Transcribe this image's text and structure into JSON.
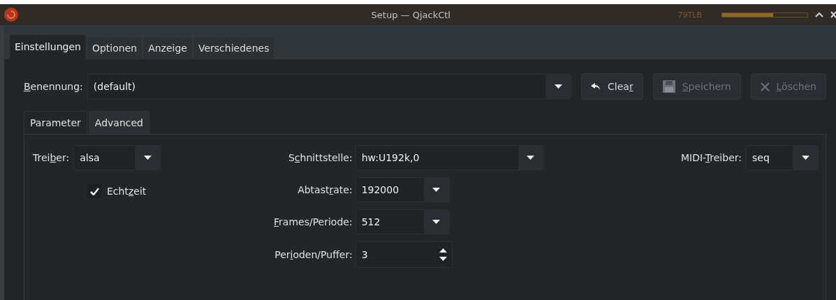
{
  "window": {
    "title": "Setup — QjackCtl",
    "overlay_text": "79TLB",
    "meter": {
      "level": 0.6
    }
  },
  "tabs": [
    {
      "label": "Einstellungen",
      "selected": true
    },
    {
      "label": "Optionen",
      "selected": false
    },
    {
      "label": "Anzeige",
      "selected": false
    },
    {
      "label": "Verschiedenes",
      "selected": false
    }
  ],
  "preset": {
    "label": {
      "key": "B",
      "after": "enennung:"
    },
    "value": "(default)"
  },
  "buttons": [
    {
      "kind": "clear",
      "label": {
        "before": "Clea",
        "key": "r"
      },
      "disabled": false
    },
    {
      "kind": "save",
      "label": {
        "key": "S",
        "after": "peichern"
      },
      "disabled": true
    },
    {
      "kind": "delete",
      "label": {
        "key": "L",
        "after": "öschen"
      },
      "disabled": true
    }
  ],
  "subtabs": [
    {
      "label": "Parameter",
      "selected": true
    },
    {
      "label": "Advanced",
      "selected": false
    }
  ],
  "driver": {
    "label": {
      "before": "Trei",
      "key": "b",
      "after": "er:"
    },
    "value": "alsa"
  },
  "realtime": {
    "label": {
      "before": "Echt",
      "key": "z",
      "after": "eit"
    },
    "checked": true
  },
  "fields": [
    {
      "kind": "wide-combo",
      "label": {
        "before": "S",
        "key": "c",
        "after": "hnittstelle:"
      },
      "value": "hw:U192k,0"
    },
    {
      "kind": "combo",
      "label": {
        "before": "Abtast",
        "key": "r",
        "after": "ate:"
      },
      "value": "192000"
    },
    {
      "kind": "combo",
      "label": {
        "key": "F",
        "after": "rames/Periode:"
      },
      "value": "512"
    },
    {
      "kind": "spin",
      "label": {
        "before": "Per",
        "key": "i",
        "after": "oden/Puffer:"
      },
      "value": "3"
    }
  ],
  "midi_driver": {
    "label": {
      "before": "MIDI-",
      "key": "T",
      "after": "reiber:"
    },
    "value": "seq"
  }
}
